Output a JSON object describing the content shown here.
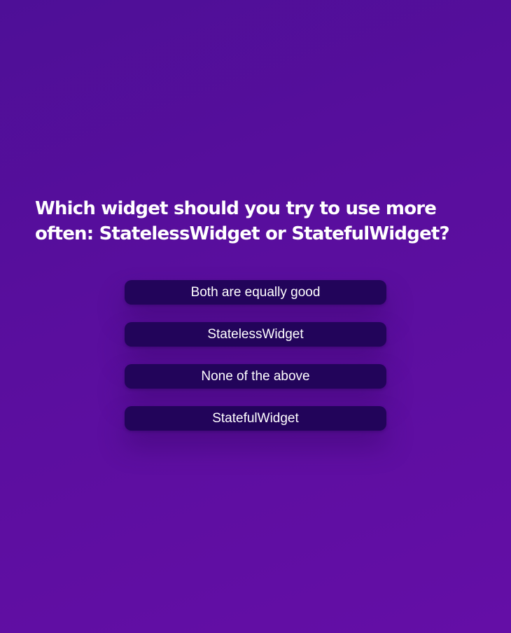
{
  "quiz": {
    "question": "Which widget should you try to use more often: StatelessWidget or StatefulWidget?",
    "answers": [
      {
        "label": "Both are equally good"
      },
      {
        "label": "StatelessWidget"
      },
      {
        "label": "None of the above"
      },
      {
        "label": "StatefulWidget"
      }
    ]
  },
  "colors": {
    "background_top": "#4e0f97",
    "background_bottom": "#640ea6",
    "answer_button": "#22045a",
    "text": "#ffffff"
  }
}
